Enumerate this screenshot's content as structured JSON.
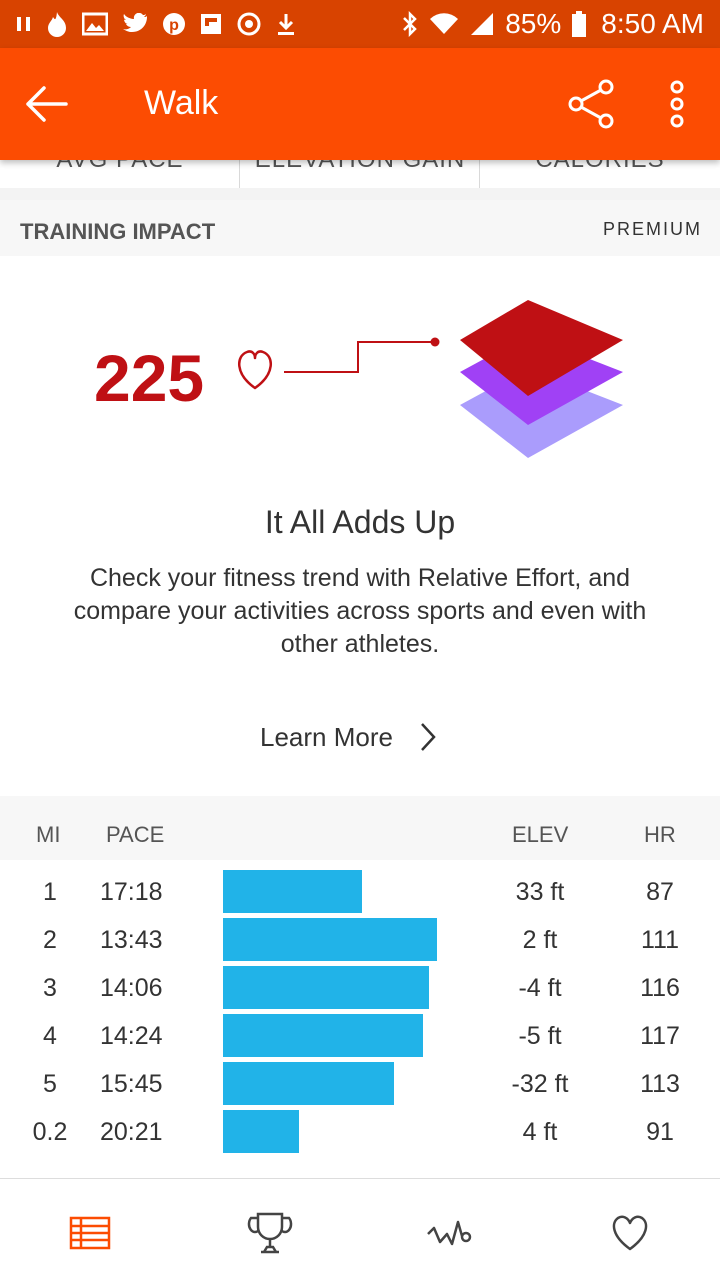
{
  "status_bar": {
    "battery": "85%",
    "time": "8:50 AM",
    "icons": [
      "pause-icon",
      "tinder-icon",
      "image-icon",
      "twitter-icon",
      "pinterest-icon",
      "flipboard-icon",
      "sync-icon",
      "download-icon",
      "bluetooth-icon",
      "wifi-icon",
      "signal-icon",
      "battery-icon"
    ]
  },
  "app_bar": {
    "title": "Walk",
    "back_icon": "arrow-left-icon",
    "share_icon": "share-icon",
    "more_icon": "more-vert-icon"
  },
  "stats_remnant": {
    "labels": [
      "AVG PACE",
      "ELEVATION GAIN",
      "CALORIES"
    ]
  },
  "training_impact": {
    "title": "TRAINING IMPACT",
    "badge": "PREMIUM",
    "score": "225",
    "promo_title": "It All Adds Up",
    "promo_body": "Check your fitness trend with Relative Effort, and compare your activities across sports and even with other athletes.",
    "learn_more": "Learn More"
  },
  "splits": {
    "headers": {
      "mi": "MI",
      "pace": "PACE",
      "elev": "ELEV",
      "hr": "HR"
    },
    "rows": [
      {
        "mi": "1",
        "pace": "17:18",
        "pace_bar": 0.649,
        "elev": "33 ft",
        "hr": "87"
      },
      {
        "mi": "2",
        "pace": "13:43",
        "pace_bar": 1.0,
        "elev": "2 ft",
        "hr": "111"
      },
      {
        "mi": "3",
        "pace": "14:06",
        "pace_bar": 0.963,
        "elev": "-4 ft",
        "hr": "116"
      },
      {
        "mi": "4",
        "pace": "14:24",
        "pace_bar": 0.935,
        "elev": "-5 ft",
        "hr": "117"
      },
      {
        "mi": "5",
        "pace": "15:45",
        "pace_bar": 0.799,
        "elev": "-32 ft",
        "hr": "113"
      },
      {
        "mi": "0.2",
        "pace": "20:21",
        "pace_bar": 0.355,
        "elev": "4 ft",
        "hr": "91"
      }
    ]
  },
  "bottom_nav": {
    "items": [
      "splits-icon",
      "trophy-icon",
      "analysis-icon",
      "heart-icon"
    ],
    "active": "splits-icon",
    "active_color": "#fc4c02"
  },
  "colors": {
    "brand": "#fc4c02",
    "status_bar": "#d84300",
    "effort_red": "#bf1014",
    "bar_blue": "#21b3e8"
  }
}
